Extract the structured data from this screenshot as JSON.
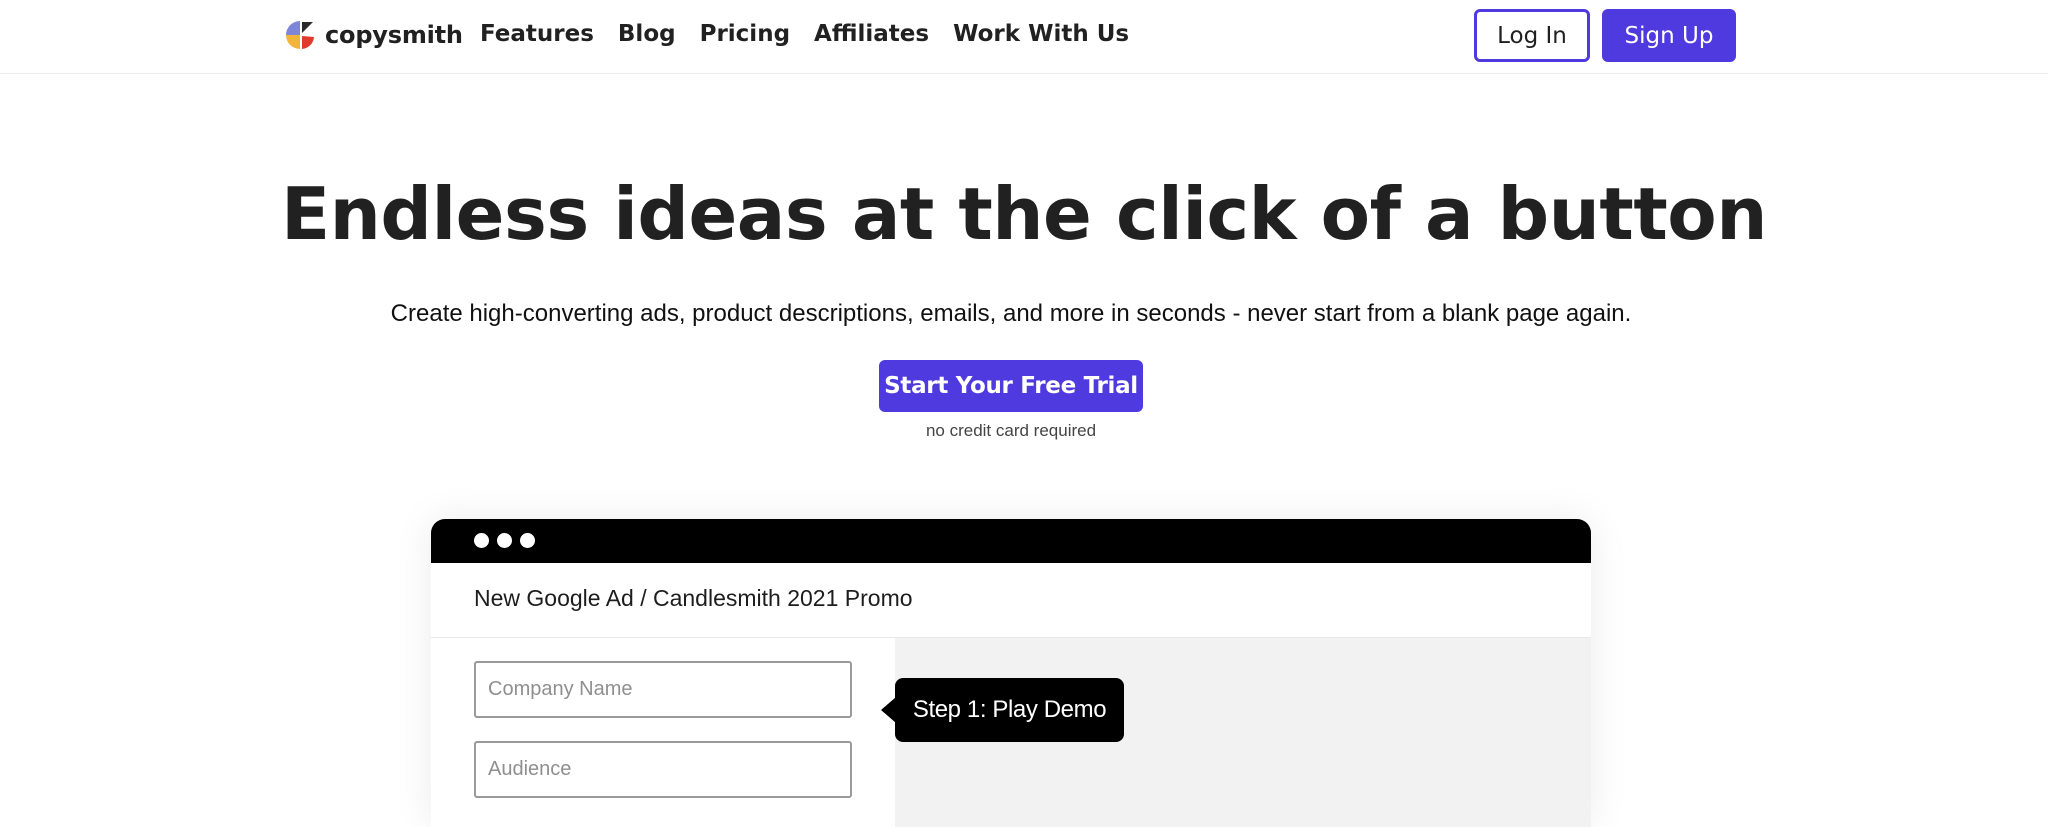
{
  "nav": {
    "brand": "copysmith",
    "links": [
      "Features",
      "Blog",
      "Pricing",
      "Affiliates",
      "Work With Us"
    ],
    "login_label": "Log In",
    "signup_label": "Sign Up"
  },
  "hero": {
    "title": "Endless ideas at the click of a button",
    "subtitle": "Create high-converting ads, product descriptions, emails, and more in seconds - never start from a blank page again.",
    "cta_label": "Start Your Free Trial",
    "cta_note": "no credit card required"
  },
  "demo": {
    "breadcrumb": "New Google Ad / Candlesmith 2021 Promo",
    "company_placeholder": "Company Name",
    "audience_placeholder": "Audience",
    "tooltip": "Step 1: Play Demo"
  },
  "colors": {
    "accent": "#4f3ae0",
    "text": "#212121",
    "panel_bg": "#f2f2f2",
    "window_bar": "#000000"
  },
  "icons": {
    "brand_logo": "copysmith-logo-icon",
    "window_controls": "window-dot-icon"
  }
}
